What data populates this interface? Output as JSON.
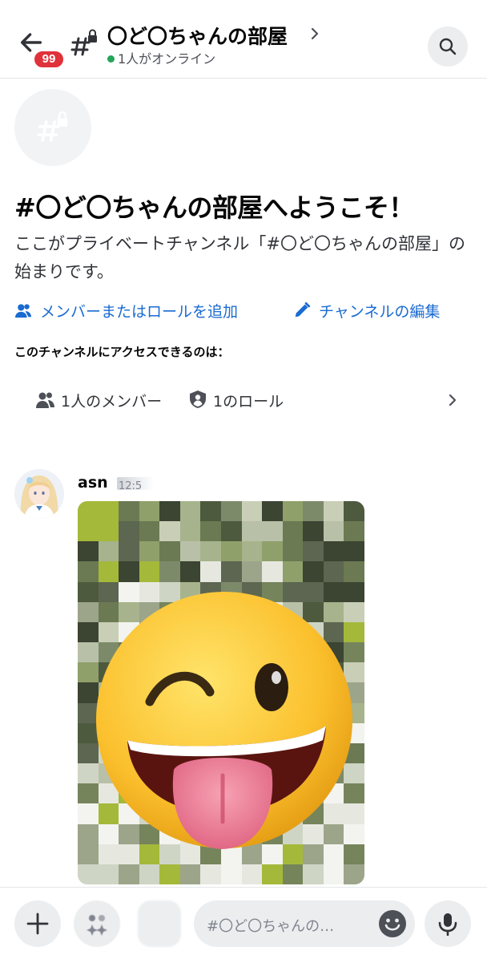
{
  "header": {
    "unread_badge": "99",
    "channel_title": "〇ど〇ちゃんの部屋",
    "online_status": "1人がオンライン"
  },
  "welcome": {
    "title": "#〇ど〇ちゃんの部屋へようこそ！",
    "description": "ここがプライベートチャンネル「#〇ど〇ちゃんの部屋」の始まりです。",
    "add_members_label": "メンバーまたはロールを追加",
    "edit_channel_label": "チャンネルの編集",
    "access_title": "このチャンネルにアクセスできるのは：",
    "members_count_label": "1人のメンバー",
    "roles_count_label": "1のロール"
  },
  "message": {
    "username": "asn",
    "timestamp": "12:5"
  },
  "composer": {
    "placeholder": "#〇ど〇ちゃんの…"
  },
  "icons": {
    "back": "arrow-left-icon",
    "channel": "hash-lock-icon",
    "search": "search-icon",
    "add_members": "person-add-icon",
    "edit": "pencil-icon",
    "members": "people-icon",
    "roles": "shield-user-icon",
    "plus": "plus-icon",
    "apps": "sparkles-icon",
    "emoji": "smile-icon",
    "mic": "microphone-icon"
  },
  "colors": {
    "accent_link": "#1a6bd1",
    "online": "#23a55a",
    "badge": "#e0323b"
  }
}
